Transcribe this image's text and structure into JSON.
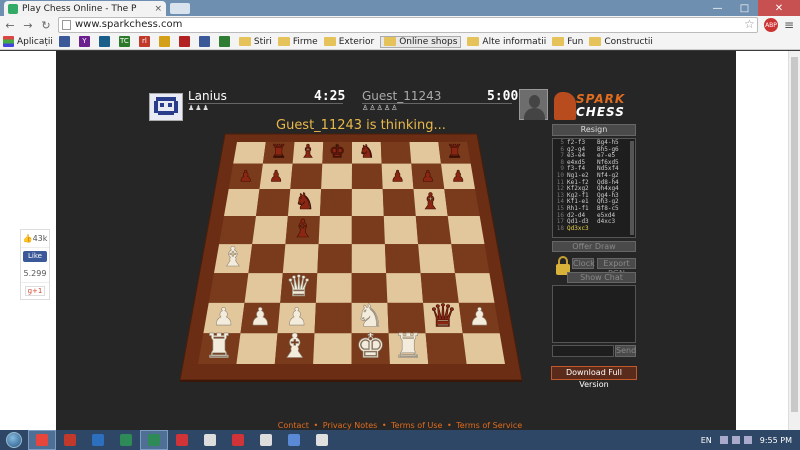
{
  "browser": {
    "tab_title": "Play Chess Online - The P",
    "tab_close": "×",
    "window_buttons": [
      "—",
      "□",
      "✕"
    ],
    "url": "www.sparkchess.com",
    "menu_icon": "≡",
    "extension_label": "ABP",
    "bookmarks": [
      {
        "label": "Aplicații",
        "type": "apps"
      },
      {
        "label": "",
        "type": "icon",
        "color": "#3b5998"
      },
      {
        "label": "Y",
        "type": "icon",
        "color": "#6b1f8f"
      },
      {
        "label": "",
        "type": "icon",
        "color": "#1a5f8a"
      },
      {
        "label": "TC",
        "type": "icon",
        "color": "#2a7a2a"
      },
      {
        "label": "rl",
        "type": "icon",
        "color": "#c0392b"
      },
      {
        "label": "",
        "type": "icon",
        "color": "#d4a017"
      },
      {
        "label": "",
        "type": "icon",
        "color": "#b22222"
      },
      {
        "label": "",
        "type": "icon",
        "color": "#3b5998"
      },
      {
        "label": "",
        "type": "icon",
        "color": "#2e7d32"
      },
      {
        "label": "Stiri",
        "type": "folder"
      },
      {
        "label": "Firme",
        "type": "folder"
      },
      {
        "label": "Exterior",
        "type": "folder"
      },
      {
        "label": "Online shops",
        "type": "folder",
        "selected": true
      },
      {
        "label": "Alte informatii",
        "type": "folder"
      },
      {
        "label": "Fun",
        "type": "folder"
      },
      {
        "label": "Constructii",
        "type": "folder"
      }
    ]
  },
  "social": {
    "likes": "43k",
    "fb_like": "Like",
    "count": "5.299",
    "gplus": "g+1"
  },
  "players": {
    "player1_name": "Lanius",
    "player1_clock": "4:25",
    "player1_captures": "♟♟♟",
    "player2_name": "Guest_11243",
    "player2_clock": "5:00",
    "player2_captures": "♙♙♙♙♙"
  },
  "logo": {
    "line1": "SPARK",
    "line2": "CHESS"
  },
  "status": "Guest_11243 is thinking...",
  "panel": {
    "resign": "Resign",
    "moves": [
      {
        "n": "5",
        "w": "f2-f3",
        "b": "Bg4-h5"
      },
      {
        "n": "6",
        "w": "g2-g4",
        "b": "Bh5-g6"
      },
      {
        "n": "7",
        "w": "e3-e4",
        "b": "e7-e5"
      },
      {
        "n": "8",
        "w": "e4xd5",
        "b": "Nf6xd5"
      },
      {
        "n": "9",
        "w": "f3-f4",
        "b": "Nd5xf4"
      },
      {
        "n": "10",
        "w": "Ng1-e2",
        "b": "Nf4-g2"
      },
      {
        "n": "11",
        "w": "Ke1-f2",
        "b": "Qd8-h4"
      },
      {
        "n": "12",
        "w": "Kf2xg2",
        "b": "Qh4xg4"
      },
      {
        "n": "13",
        "w": "Kg2-f1",
        "b": "Qg4-h3"
      },
      {
        "n": "14",
        "w": "Kf1-e1",
        "b": "Qh3-g2"
      },
      {
        "n": "15",
        "w": "Rh1-f1",
        "b": "Bf8-c5"
      },
      {
        "n": "16",
        "w": "d2-d4",
        "b": "e5xd4"
      },
      {
        "n": "17",
        "w": "Qd1-d3",
        "b": "d4xc3"
      },
      {
        "n": "18",
        "w": "Qd3xc3",
        "b": ""
      }
    ],
    "offer_draw": "Offer Draw",
    "clock_btn": "Clock",
    "export": "Export PGN",
    "show_chat": "Show Chat",
    "send": "Send",
    "download": "Download Full Version"
  },
  "footer": {
    "contact": "Contact",
    "privacy": "Privacy Notes",
    "terms_use": "Terms of Use",
    "terms_service": "Terms of Service",
    "sep": "•"
  },
  "taskbar": {
    "lang": "EN",
    "time": "9:55 PM",
    "apps": [
      {
        "name": "chrome",
        "color": "#e8453c",
        "active": true
      },
      {
        "name": "app-2",
        "color": "#c0392b"
      },
      {
        "name": "app-3",
        "color": "#2c6fbf"
      },
      {
        "name": "app-4",
        "color": "#2e8b57"
      },
      {
        "name": "app-5",
        "color": "#2e8b57",
        "active": true
      },
      {
        "name": "app-6",
        "color": "#d13438"
      },
      {
        "name": "app-7",
        "color": "#ddd"
      },
      {
        "name": "app-8",
        "color": "#d13438"
      },
      {
        "name": "app-9",
        "color": "#ddd"
      },
      {
        "name": "app-10",
        "color": "#5a8ad6"
      },
      {
        "name": "app-11",
        "color": "#e0e0e0"
      }
    ]
  },
  "board": {
    "light": "#e2c79c",
    "dark": "#7a3b1c",
    "frame": "#6b2e14",
    "pieces": [
      {
        "sq": "b8",
        "t": "R",
        "c": "b"
      },
      {
        "sq": "c8",
        "t": "B",
        "c": "b"
      },
      {
        "sq": "d8",
        "t": "K",
        "c": "b"
      },
      {
        "sq": "e8",
        "t": "N",
        "c": "b"
      },
      {
        "sq": "h8",
        "t": "R",
        "c": "b"
      },
      {
        "sq": "a7",
        "t": "P",
        "c": "b"
      },
      {
        "sq": "b7",
        "t": "P",
        "c": "b"
      },
      {
        "sq": "f7",
        "t": "P",
        "c": "b"
      },
      {
        "sq": "g7",
        "t": "P",
        "c": "b"
      },
      {
        "sq": "g6",
        "t": "B",
        "c": "b"
      },
      {
        "sq": "c6",
        "t": "N",
        "c": "b"
      },
      {
        "sq": "c5",
        "t": "B",
        "c": "b"
      },
      {
        "sq": "h7",
        "t": "P",
        "c": "b"
      },
      {
        "sq": "a4",
        "t": "B",
        "c": "w"
      },
      {
        "sq": "c3",
        "t": "Q",
        "c": "w"
      },
      {
        "sq": "g2",
        "t": "Q",
        "c": "b"
      },
      {
        "sq": "a2",
        "t": "P",
        "c": "w"
      },
      {
        "sq": "b2",
        "t": "P",
        "c": "w"
      },
      {
        "sq": "c2",
        "t": "P",
        "c": "w"
      },
      {
        "sq": "e2",
        "t": "N",
        "c": "w"
      },
      {
        "sq": "h2",
        "t": "P",
        "c": "w"
      },
      {
        "sq": "a1",
        "t": "R",
        "c": "w"
      },
      {
        "sq": "c1",
        "t": "B",
        "c": "w"
      },
      {
        "sq": "e1",
        "t": "K",
        "c": "w"
      },
      {
        "sq": "f1",
        "t": "R",
        "c": "w"
      }
    ]
  }
}
